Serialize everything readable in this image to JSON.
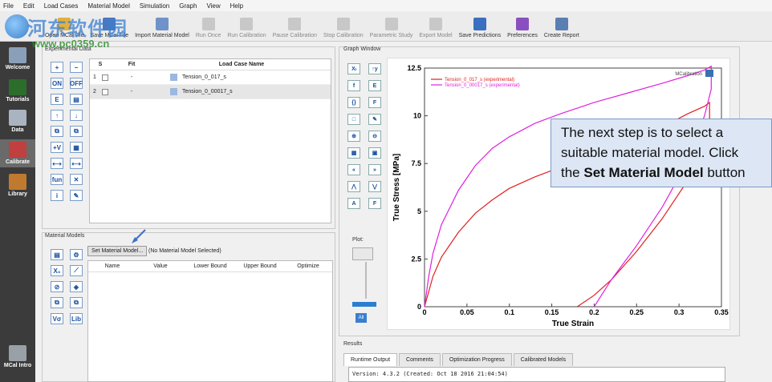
{
  "menu": [
    "File",
    "Edit",
    "Load Cases",
    "Material Model",
    "Simulation",
    "Graph",
    "View",
    "Help"
  ],
  "watermark": {
    "title": "河东软件园",
    "url": "www.pc0359.cn"
  },
  "toolbar": [
    {
      "label": "Open MCal File",
      "icon": "folder-open-icon",
      "color": "#e0b040",
      "disabled": false
    },
    {
      "label": "Save MCal File",
      "icon": "save-icon",
      "color": "#4a78c0",
      "disabled": false
    },
    {
      "label": "Import Material Model",
      "icon": "import-icon",
      "color": "#6f93c8",
      "disabled": false
    },
    {
      "label": "Run Once",
      "icon": "run-once-icon",
      "color": "#c8c8c8",
      "disabled": true
    },
    {
      "label": "Run Calibration",
      "icon": "run-calibration-icon",
      "color": "#c8c8c8",
      "disabled": true
    },
    {
      "label": "Pause Calibration",
      "icon": "pause-icon",
      "color": "#c8c8c8",
      "disabled": true
    },
    {
      "label": "Stop Calibration",
      "icon": "stop-icon",
      "color": "#c8c8c8",
      "disabled": true
    },
    {
      "label": "Parametric Study",
      "icon": "parametric-icon",
      "color": "#c8c8c8",
      "disabled": true
    },
    {
      "label": "Export Model",
      "icon": "export-icon",
      "color": "#c8c8c8",
      "disabled": true
    },
    {
      "label": "Save Predictions",
      "icon": "save-predictions-icon",
      "color": "#3b6fc0",
      "disabled": false
    },
    {
      "label": "Preferences",
      "icon": "preferences-icon",
      "color": "#8a4fbf",
      "disabled": false
    },
    {
      "label": "Create Report",
      "icon": "report-icon",
      "color": "#5a7fb0",
      "disabled": false
    }
  ],
  "sidebar": [
    {
      "label": "Welcome",
      "icon": "welcome-icon",
      "color": "#8aa0b8"
    },
    {
      "label": "Tutorials",
      "icon": "tutorials-icon",
      "color": "#2c6d2c"
    },
    {
      "label": "Data",
      "icon": "data-icon",
      "color": "#aab4c0"
    },
    {
      "label": "Calibrate",
      "icon": "calibrate-icon",
      "color": "#c04040",
      "selected": true
    },
    {
      "label": "Library",
      "icon": "library-icon",
      "color": "#c07a30"
    },
    {
      "label": "MCal Intro",
      "icon": "intro-icon",
      "color": "#9aa0a8"
    }
  ],
  "experimental": {
    "title": "Experimental Data",
    "headers": [
      "S",
      "Fit",
      "Load Case Name"
    ],
    "rows": [
      {
        "num": "1",
        "fit": "-",
        "name": "Tension_0_017_s"
      },
      {
        "num": "2",
        "fit": "-",
        "name": "Tension_0_00017_s"
      }
    ],
    "buttons": [
      "+",
      "−",
      "ON",
      "OFF",
      "E",
      "▤",
      "↑",
      "↓",
      "⧉",
      "⧉",
      "+V",
      "▦",
      "⟷",
      "⟷",
      "fun",
      "✕",
      "i",
      "✎"
    ]
  },
  "material_models": {
    "title": "Material Models",
    "set_button": "Set Material Model...",
    "status": "(No Material Model Selected)",
    "headers": [
      "Name",
      "Value",
      "Lower Bound",
      "Upper Bound",
      "Optimize"
    ],
    "buttons": [
      "▤",
      "⚙",
      "X₀",
      "⟋",
      "⊘",
      "◈",
      "⧉",
      "⧉",
      "Vσ",
      "Lib"
    ]
  },
  "graph": {
    "title": "Graph Window",
    "buttons": [
      "Xₗ",
      "↑y",
      "f",
      "E",
      "{}",
      "F",
      "□",
      "✎",
      "⊕",
      "⊖",
      "▦",
      "▣",
      "«",
      "»",
      "⋀",
      "⋁",
      "A",
      "F"
    ],
    "plot_label": "Plot:",
    "all_button": "All",
    "watermark": "MCalibration"
  },
  "chart_data": {
    "type": "line",
    "xlabel": "True Strain",
    "ylabel": "True Stress [MPa]",
    "xlim": [
      0,
      0.35
    ],
    "ylim": [
      0,
      12.5
    ],
    "xticks": [
      "0",
      "0.05",
      "0.1",
      "0.15",
      "0.2",
      "0.25",
      "0.3",
      "0.35"
    ],
    "yticks": [
      "0",
      "2.5",
      "5",
      "7.5",
      "10",
      "12.5"
    ],
    "series": [
      {
        "name": "Tension_0_017_s (experimental)",
        "color": "#e02020",
        "x": [
          0,
          0.01,
          0.02,
          0.04,
          0.06,
          0.08,
          0.1,
          0.13,
          0.16,
          0.2,
          0.24,
          0.28,
          0.31,
          0.33,
          0.336,
          0.336,
          0.33,
          0.31,
          0.28,
          0.25,
          0.22,
          0.2,
          0.18
        ],
        "y": [
          0,
          1.6,
          2.6,
          3.9,
          4.9,
          5.6,
          6.2,
          6.8,
          7.3,
          7.9,
          8.6,
          9.4,
          10.1,
          10.5,
          10.7,
          9.8,
          8.6,
          6.6,
          4.6,
          2.9,
          1.4,
          0.6,
          0
        ]
      },
      {
        "name": "Tension_0_00017_s (experimental)",
        "color": "#e020e0",
        "x": [
          0,
          0.005,
          0.01,
          0.02,
          0.04,
          0.06,
          0.08,
          0.1,
          0.13,
          0.16,
          0.2,
          0.24,
          0.28,
          0.31,
          0.33,
          0.338,
          0.338,
          0.33,
          0.31,
          0.28,
          0.25,
          0.22,
          0.2
        ],
        "y": [
          0,
          1.6,
          2.8,
          4.3,
          6.1,
          7.4,
          8.3,
          8.9,
          9.6,
          10.1,
          10.7,
          11.2,
          11.7,
          12.1,
          12.4,
          12.6,
          11.4,
          10.0,
          7.6,
          5.2,
          3.2,
          1.4,
          0
        ]
      }
    ],
    "legend": "top-left",
    "grid": false
  },
  "callout": {
    "line1": "The next step is to select a",
    "line2": "suitable material model. Click",
    "line3_pre": "the ",
    "line3_bold": "Set Material Model",
    "line3_post": " button"
  },
  "results": {
    "title": "Results",
    "tabs": [
      "Runtime Output",
      "Comments",
      "Optimization Progress",
      "Calibrated Models"
    ],
    "text": "Version: 4.3.2 (Created: Oct 18 2016 21:04:54)"
  }
}
